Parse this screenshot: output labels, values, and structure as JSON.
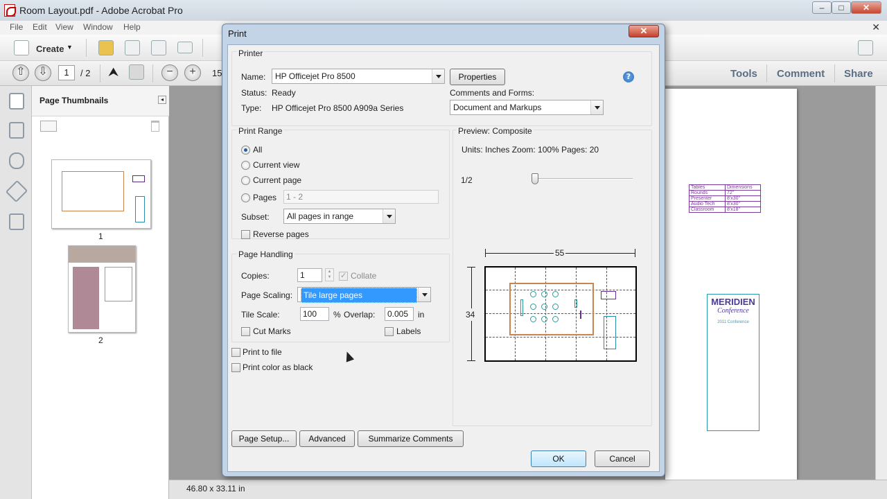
{
  "window": {
    "title": "Room Layout.pdf - Adobe Acrobat Pro",
    "min": "–",
    "max": "□",
    "close": "✕"
  },
  "menu": {
    "items": [
      "File",
      "Edit",
      "View",
      "Window",
      "Help"
    ],
    "close_doc": "✕"
  },
  "toolbar": {
    "create_label": "Create",
    "page_current": "1",
    "page_total": "/ 2",
    "zoom": "15"
  },
  "panels": {
    "tools": "Tools",
    "comment": "Comment",
    "share": "Share"
  },
  "thumbnails": {
    "title": "Page Thumbnails",
    "pages": [
      "1",
      "2"
    ]
  },
  "status": {
    "size": "46.80 x 33.11 in"
  },
  "dialog": {
    "title": "Print",
    "close": "✕",
    "printer": {
      "group": "Printer",
      "name_label": "Name:",
      "name_value": "HP Officejet Pro 8500",
      "properties": "Properties",
      "status_label": "Status:",
      "status_value": "Ready",
      "type_label": "Type:",
      "type_value": "HP Officejet Pro 8500 A909a Series",
      "comments_label": "Comments and Forms:",
      "comments_value": "Document and Markups",
      "help": "?"
    },
    "range": {
      "group": "Print Range",
      "all": "All",
      "current_view": "Current view",
      "current_page": "Current page",
      "pages": "Pages",
      "pages_value": "1 - 2",
      "subset_label": "Subset:",
      "subset_value": "All pages in range",
      "reverse": "Reverse pages"
    },
    "handling": {
      "group": "Page Handling",
      "copies_label": "Copies:",
      "copies_value": "1",
      "collate": "Collate",
      "scaling_label": "Page Scaling:",
      "scaling_value": "Tile large pages",
      "tile_scale_label": "Tile Scale:",
      "tile_scale_value": "100",
      "percent": "%",
      "overlap_label": "Overlap:",
      "overlap_value": "0.005",
      "overlap_unit": "in",
      "cut_marks": "Cut Marks",
      "labels": "Labels"
    },
    "print_to_file": "Print to file",
    "print_color_black": "Print color as black",
    "preview": {
      "title": "Preview: Composite",
      "info": "Units: Inches Zoom: 100% Pages: 20",
      "page_indicator": "1/2",
      "width_dim": "55",
      "height_dim": "34"
    },
    "buttons": {
      "page_setup": "Page Setup...",
      "advanced": "Advanced",
      "summarize": "Summarize Comments",
      "ok": "OK",
      "cancel": "Cancel"
    }
  },
  "doc_page": {
    "table": [
      [
        "Tables",
        "Dimensions"
      ],
      [
        "Rounds",
        "72\""
      ],
      [
        "Presenter",
        "8'x30\""
      ],
      [
        "Audio Tech",
        "8'x30\""
      ],
      [
        "Classroom",
        "8'x18\""
      ]
    ],
    "logo": "MERIDIEN",
    "logo_sub": "Conference",
    "year_line": "2011 Conference"
  }
}
